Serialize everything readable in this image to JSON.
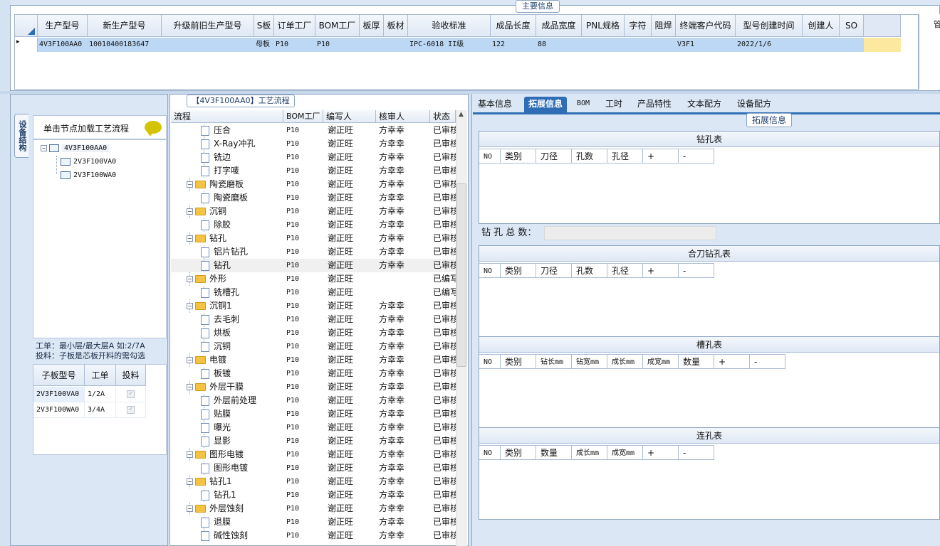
{
  "top": {
    "section_title": "主要信息",
    "columns": [
      "生产型号",
      "新生产型号",
      "升级前旧生产型号",
      "S板",
      "订单工厂",
      "BOM工厂",
      "板厚",
      "板材",
      "验收标准",
      "成品长度",
      "成品宽度",
      "PNL规格",
      "字符",
      "阻焊",
      "终端客户代码",
      "型号创建时间",
      "创建人",
      "SO"
    ],
    "row": [
      "4V3F100AA0",
      "10010400183647",
      "",
      "母板",
      "P10",
      "P10",
      "",
      "",
      "IPC-6018 II级",
      "122",
      "88",
      "",
      "",
      "",
      "V3F1",
      "2022/1/6",
      "",
      ""
    ],
    "row_marker": "▸",
    "right_edge_text": "管"
  },
  "left": {
    "vertical_tab": "设备结构",
    "load_label": "单击节点加载工艺流程",
    "tree": [
      {
        "label": "4V3F100AA0",
        "level": 0,
        "toggle": "−"
      },
      {
        "label": "2V3F100VA0",
        "level": 1
      },
      {
        "label": "2V3F100WA0",
        "level": 1
      }
    ],
    "note_line1": "工单：最小层/最大层A 如:2/7A",
    "note_line2": "投料：子板是芯板开料的需勾选",
    "subgrid": {
      "headers": [
        "子板型号",
        "工单",
        "投料"
      ],
      "rows": [
        [
          "2V3F100VA0",
          "1/2A",
          "✓"
        ],
        [
          "2V3F100WA0",
          "3/4A",
          "✓"
        ]
      ]
    }
  },
  "middle": {
    "title": "【4V3F100AA0】工艺流程",
    "headers": [
      "流程",
      "BOM工厂",
      "编写人",
      "核审人",
      "状态"
    ],
    "rows": [
      {
        "name": "压合",
        "type": "item",
        "bom": "P10",
        "writer": "谢正旺",
        "reviewer": "方幸幸",
        "status": "已审核"
      },
      {
        "name": "X-Ray冲孔",
        "type": "item",
        "bom": "P10",
        "writer": "谢正旺",
        "reviewer": "方幸幸",
        "status": "已审核"
      },
      {
        "name": "铣边",
        "type": "item",
        "bom": "P10",
        "writer": "谢正旺",
        "reviewer": "方幸幸",
        "status": "已审核"
      },
      {
        "name": "打字唛",
        "type": "item",
        "bom": "P10",
        "writer": "谢正旺",
        "reviewer": "方幸幸",
        "status": "已审核"
      },
      {
        "name": "陶瓷磨板",
        "type": "folder",
        "bom": "P10",
        "writer": "谢正旺",
        "reviewer": "方幸幸",
        "status": "已审核"
      },
      {
        "name": "陶瓷磨板",
        "type": "item",
        "bom": "P10",
        "writer": "谢正旺",
        "reviewer": "方幸幸",
        "status": "已审核"
      },
      {
        "name": "沉铜",
        "type": "folder",
        "bom": "P10",
        "writer": "谢正旺",
        "reviewer": "方幸幸",
        "status": "已审核"
      },
      {
        "name": "除胶",
        "type": "item",
        "bom": "P10",
        "writer": "谢正旺",
        "reviewer": "方幸幸",
        "status": "已审核"
      },
      {
        "name": "钻孔",
        "type": "folder",
        "bom": "P10",
        "writer": "谢正旺",
        "reviewer": "方幸幸",
        "status": "已审核"
      },
      {
        "name": "铝片钻孔",
        "type": "item",
        "bom": "P10",
        "writer": "谢正旺",
        "reviewer": "方幸幸",
        "status": "已审核"
      },
      {
        "name": "钻孔",
        "type": "item",
        "bom": "P10",
        "writer": "谢正旺",
        "reviewer": "方幸幸",
        "status": "已审核",
        "selected": true
      },
      {
        "name": "外形",
        "type": "folder",
        "bom": "P10",
        "writer": "谢正旺",
        "reviewer": "",
        "status": "已编写"
      },
      {
        "name": "铣槽孔",
        "type": "item",
        "bom": "P10",
        "writer": "谢正旺",
        "reviewer": "",
        "status": "已编写"
      },
      {
        "name": "沉铜1",
        "type": "folder",
        "bom": "P10",
        "writer": "谢正旺",
        "reviewer": "方幸幸",
        "status": "已审核"
      },
      {
        "name": "去毛刺",
        "type": "item",
        "bom": "P10",
        "writer": "谢正旺",
        "reviewer": "方幸幸",
        "status": "已审核"
      },
      {
        "name": "烘板",
        "type": "item",
        "bom": "P10",
        "writer": "谢正旺",
        "reviewer": "方幸幸",
        "status": "已审核"
      },
      {
        "name": "沉铜",
        "type": "item",
        "bom": "P10",
        "writer": "谢正旺",
        "reviewer": "方幸幸",
        "status": "已审核"
      },
      {
        "name": "电镀",
        "type": "folder",
        "bom": "P10",
        "writer": "谢正旺",
        "reviewer": "方幸幸",
        "status": "已审核"
      },
      {
        "name": "板镀",
        "type": "item",
        "bom": "P10",
        "writer": "谢正旺",
        "reviewer": "方幸幸",
        "status": "已审核"
      },
      {
        "name": "外层干膜",
        "type": "folder",
        "bom": "P10",
        "writer": "谢正旺",
        "reviewer": "方幸幸",
        "status": "已审核"
      },
      {
        "name": "外层前处理",
        "type": "item",
        "bom": "P10",
        "writer": "谢正旺",
        "reviewer": "方幸幸",
        "status": "已审核"
      },
      {
        "name": "贴膜",
        "type": "item",
        "bom": "P10",
        "writer": "谢正旺",
        "reviewer": "方幸幸",
        "status": "已审核"
      },
      {
        "name": "曝光",
        "type": "item",
        "bom": "P10",
        "writer": "谢正旺",
        "reviewer": "方幸幸",
        "status": "已审核"
      },
      {
        "name": "显影",
        "type": "item",
        "bom": "P10",
        "writer": "谢正旺",
        "reviewer": "方幸幸",
        "status": "已审核"
      },
      {
        "name": "图形电镀",
        "type": "folder",
        "bom": "P10",
        "writer": "谢正旺",
        "reviewer": "方幸幸",
        "status": "已审核"
      },
      {
        "name": "图形电镀",
        "type": "item",
        "bom": "P10",
        "writer": "谢正旺",
        "reviewer": "方幸幸",
        "status": "已审核"
      },
      {
        "name": "钻孔1",
        "type": "folder",
        "bom": "P10",
        "writer": "谢正旺",
        "reviewer": "方幸幸",
        "status": "已审核"
      },
      {
        "name": "钻孔1",
        "type": "item",
        "bom": "P10",
        "writer": "谢正旺",
        "reviewer": "方幸幸",
        "status": "已审核"
      },
      {
        "name": "外层蚀刻",
        "type": "folder",
        "bom": "P10",
        "writer": "谢正旺",
        "reviewer": "方幸幸",
        "status": "已审核"
      },
      {
        "name": "退膜",
        "type": "item",
        "bom": "P10",
        "writer": "谢正旺",
        "reviewer": "方幸幸",
        "status": "已审核"
      },
      {
        "name": "碱性蚀刻",
        "type": "item",
        "bom": "P10",
        "writer": "谢正旺",
        "reviewer": "方幸幸",
        "status": "已审核"
      }
    ]
  },
  "right": {
    "tabs": [
      "基本信息",
      "拓展信息",
      "BOM",
      "工时",
      "产品特性",
      "文本配方",
      "设备配方"
    ],
    "active_tab": 1,
    "section_title": "拓展信息",
    "drill_table": {
      "title": "钻孔表",
      "columns": [
        "NO",
        "类别",
        "刀径",
        "孔数",
        "孔径",
        "+",
        "-"
      ]
    },
    "drill_total_label": "钻 孔 总 数：",
    "combo_table": {
      "title": "合刀钻孔表",
      "columns": [
        "NO",
        "类别",
        "刀径",
        "孔数",
        "孔径",
        "+",
        "-"
      ]
    },
    "slot_table": {
      "title": "槽孔表",
      "columns": [
        "NO",
        "类别",
        "钻长mm",
        "钻宽mm",
        "成长mm",
        "成宽mm",
        "数量",
        "+",
        "-"
      ]
    },
    "link_table": {
      "title": "连孔表",
      "columns": [
        "NO",
        "类别",
        "数量",
        "成长mm",
        "成宽mm",
        "+",
        "-"
      ]
    }
  },
  "colors": {
    "accent": "#2f6db5",
    "selected_row": "#bcd8f5",
    "folder": "#f5c342",
    "highlight_cell": "#fde8a0"
  }
}
